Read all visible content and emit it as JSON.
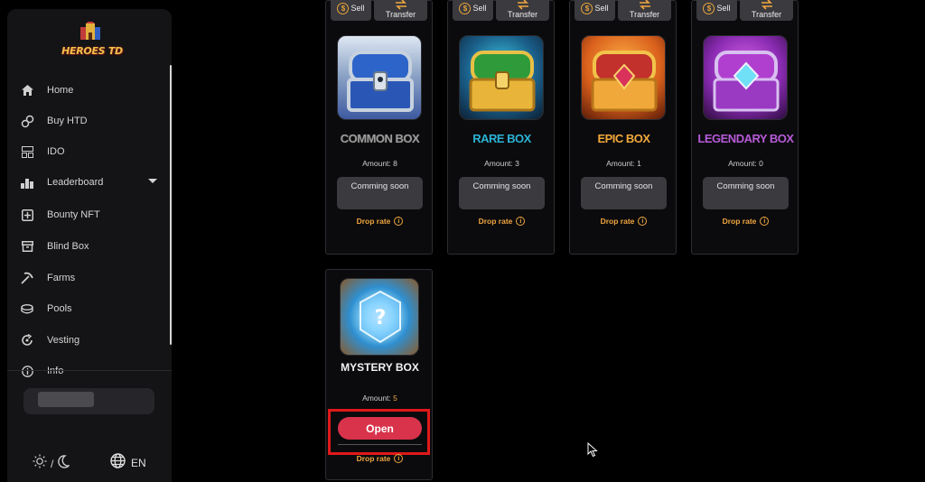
{
  "app": {
    "logo_text": "HEROES TD"
  },
  "sidebar": {
    "items": [
      {
        "label": "Home",
        "icon": "home-icon"
      },
      {
        "label": "Buy HTD",
        "icon": "link-icon"
      },
      {
        "label": "IDO",
        "icon": "ido-icon"
      },
      {
        "label": "Leaderboard",
        "icon": "leaderboard-icon"
      },
      {
        "label": "Bounty NFT",
        "icon": "bounty-icon"
      },
      {
        "label": "Blind Box",
        "icon": "box-icon"
      },
      {
        "label": "Farms",
        "icon": "pickaxe-icon"
      },
      {
        "label": "Pools",
        "icon": "pools-icon"
      },
      {
        "label": "Vesting",
        "icon": "vesting-icon"
      },
      {
        "label": "Info",
        "icon": "info-icon"
      }
    ],
    "theme_separator": "/",
    "language": "EN"
  },
  "card_actions": {
    "sell": "Sell",
    "transfer": "Transfer"
  },
  "boxes": [
    {
      "name": "COMMON BOX",
      "amount_label": "Amount:",
      "amount": "8",
      "status": "Comming soon",
      "drop_rate": "Drop rate",
      "color": "#9a9a9a"
    },
    {
      "name": "RARE BOX",
      "amount_label": "Amount:",
      "amount": "3",
      "status": "Comming soon",
      "drop_rate": "Drop rate",
      "color": "#2bb3d6"
    },
    {
      "name": "EPIC BOX",
      "amount_label": "Amount:",
      "amount": "1",
      "status": "Comming soon",
      "drop_rate": "Drop rate",
      "color": "#f2a93b"
    },
    {
      "name": "LEGENDARY BOX",
      "amount_label": "Amount:",
      "amount": "0",
      "status": "Comming soon",
      "drop_rate": "Drop rate",
      "color": "#b75ad8"
    }
  ],
  "mystery": {
    "name": "MYSTERY BOX",
    "amount_label": "Amount:",
    "amount": "5",
    "action": "Open",
    "drop_rate": "Drop rate"
  },
  "colors": {
    "accent": "#f0a640",
    "open_button": "#d9334c",
    "highlight": "#e01919"
  }
}
